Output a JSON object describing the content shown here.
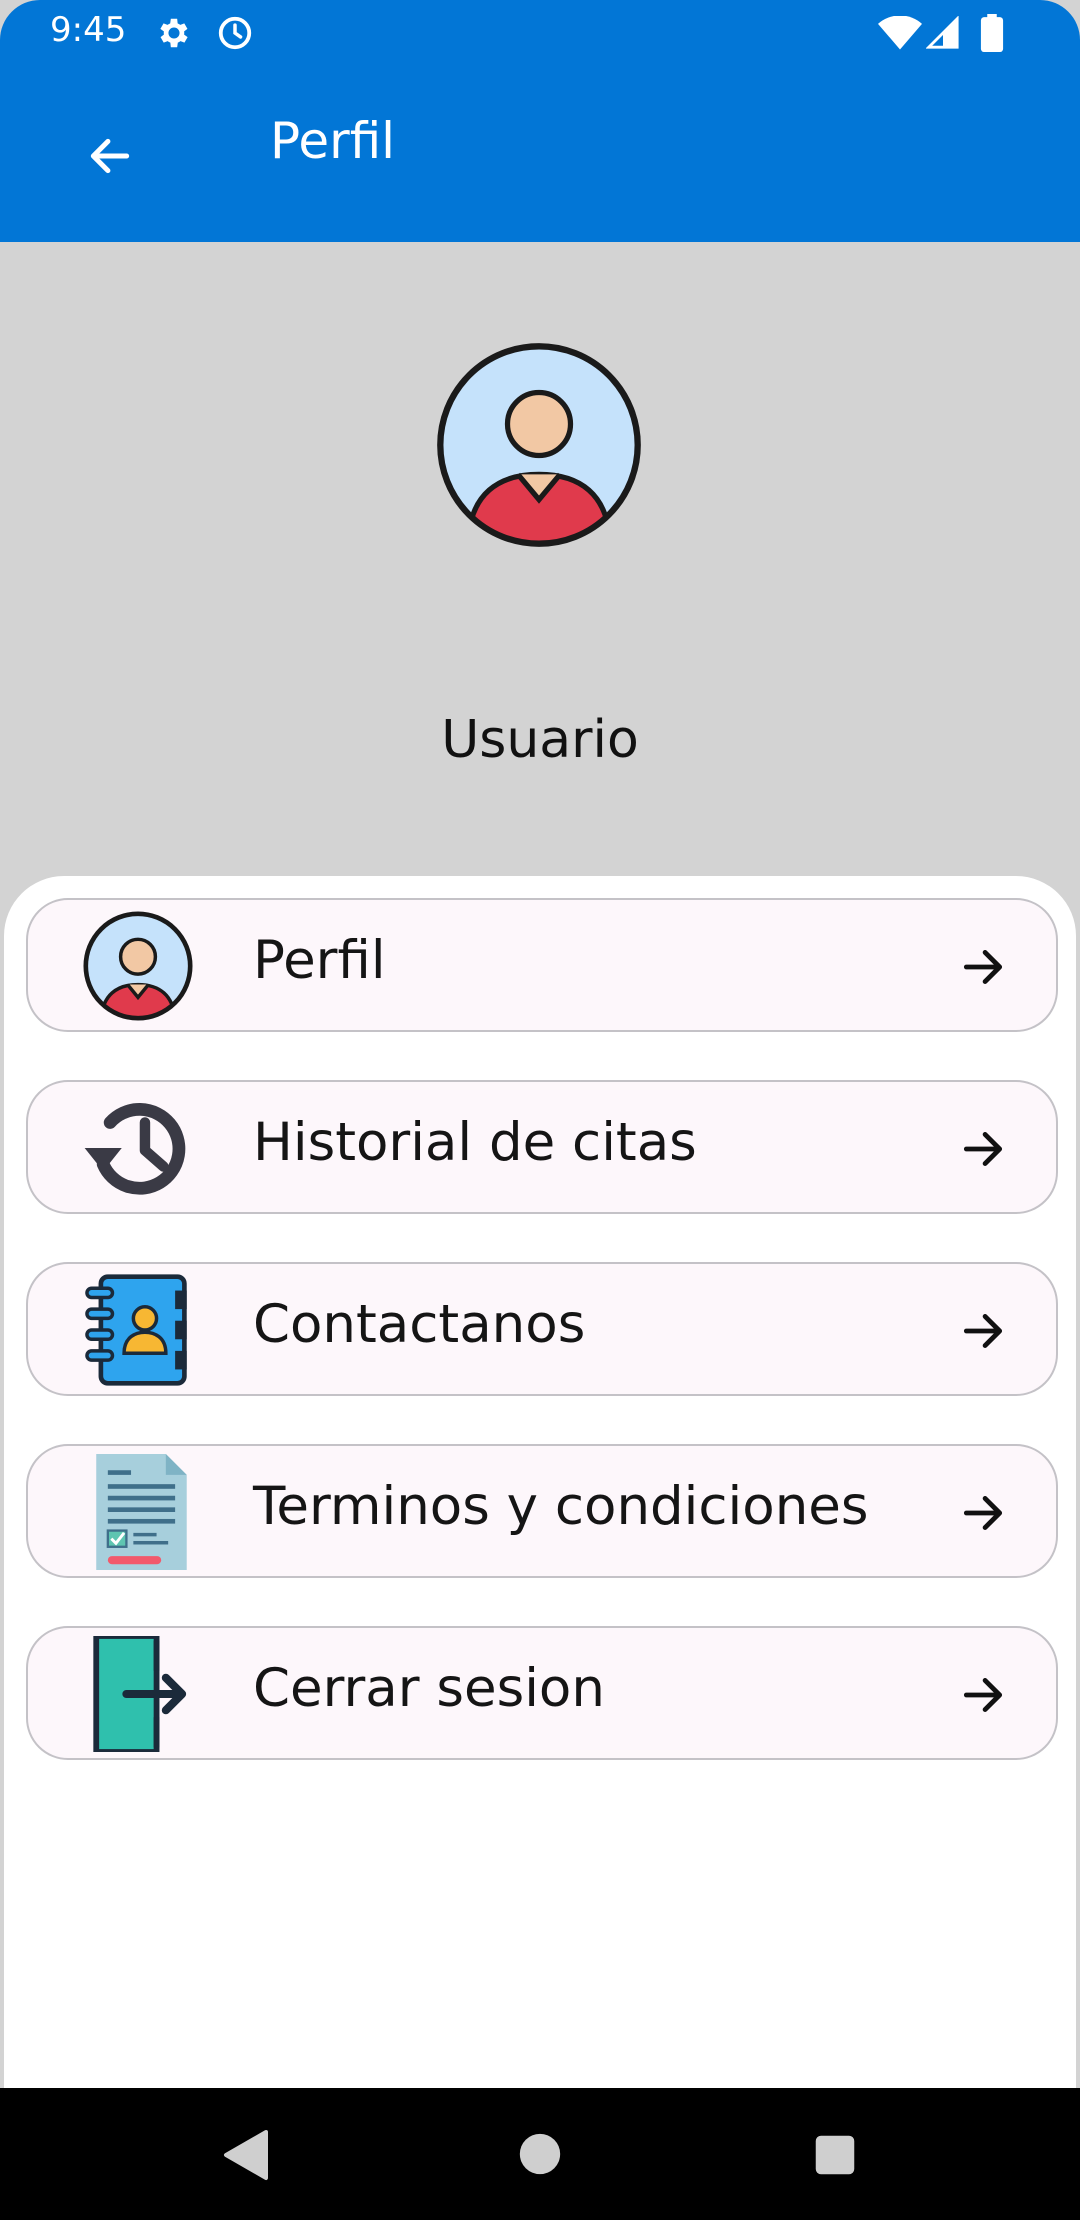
{
  "status_bar": {
    "time": "9:45",
    "icons": [
      "gear-icon",
      "alarm-clock-icon",
      "wifi-icon",
      "signal-icon",
      "battery-icon"
    ]
  },
  "app_bar": {
    "title": "Perfil",
    "back_icon": "arrow-left-icon",
    "color": "#0276d6"
  },
  "profile": {
    "avatar_icon": "user-avatar-icon",
    "name": "Usuario"
  },
  "menu": {
    "items": [
      {
        "label": "Perfil",
        "icon": "user-avatar-icon"
      },
      {
        "label": "Historial de citas",
        "icon": "history-icon"
      },
      {
        "label": "Contactanos",
        "icon": "contact-book-icon"
      },
      {
        "label": "Terminos y condiciones",
        "icon": "document-icon"
      },
      {
        "label": "Cerrar sesion",
        "icon": "logout-door-icon"
      }
    ],
    "chevron_icon": "arrow-right-icon"
  },
  "nav_bar": {
    "buttons": [
      "back-triangle-icon",
      "home-circle-icon",
      "recents-square-icon"
    ]
  }
}
